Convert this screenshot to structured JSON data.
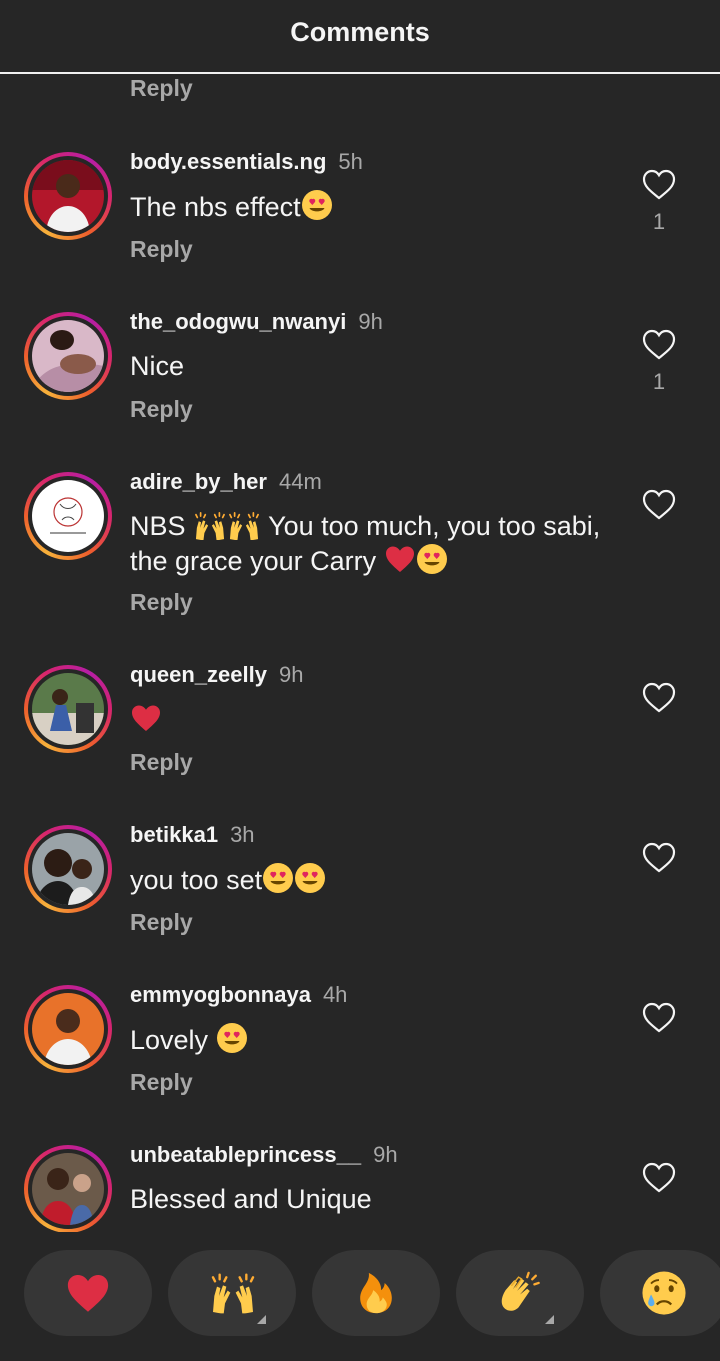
{
  "header": {
    "title": "Comments"
  },
  "top_reply_label": "Reply",
  "comments": [
    {
      "username": "body.essentials.ng",
      "time": "5h",
      "text": "The nbs effect",
      "reply_label": "Reply",
      "like_count": "1",
      "avatar_icon": "person-red-background"
    },
    {
      "username": "the_odogwu_nwanyi",
      "time": "9h",
      "text": "Nice",
      "reply_label": "Reply",
      "like_count": "1",
      "avatar_icon": "person-lying-pink"
    },
    {
      "username": "adire_by_her",
      "time": "44m",
      "text_line1": "NBS",
      "text_line1b": "You too much, you too sabi,",
      "text_line2": "the grace your Carry",
      "reply_label": "Reply",
      "avatar_icon": "brand-logo-white"
    },
    {
      "username": "queen_zeelly",
      "time": "9h",
      "reply_label": "Reply",
      "avatar_icon": "person-outdoor-chairs"
    },
    {
      "username": "betikka1",
      "time": "3h",
      "text": "you too set",
      "reply_label": "Reply",
      "avatar_icon": "two-people-selfie"
    },
    {
      "username": "emmyogbonnaya",
      "time": "4h",
      "text": "Lovely",
      "reply_label": "Reply",
      "avatar_icon": "man-orange-background"
    },
    {
      "username": "unbeatableprincess__",
      "time": "9h",
      "text": "Blessed and Unique",
      "avatar_icon": "child-with-toddler"
    }
  ],
  "quick_reactions": [
    {
      "icon": "red-heart-emoji"
    },
    {
      "icon": "raising-hands-emoji",
      "has_variants": true
    },
    {
      "icon": "fire-emoji"
    },
    {
      "icon": "clapping-hands-emoji",
      "has_variants": true
    },
    {
      "icon": "crying-face-emoji"
    }
  ],
  "colors": {
    "background": "#262626",
    "text": "#f5f5f5",
    "secondary_text": "#a8a8a8",
    "reaction_button": "#363636",
    "story_ring": [
      "#f7b13b",
      "#ee5f2c",
      "#d6246f",
      "#b51ea6"
    ]
  }
}
